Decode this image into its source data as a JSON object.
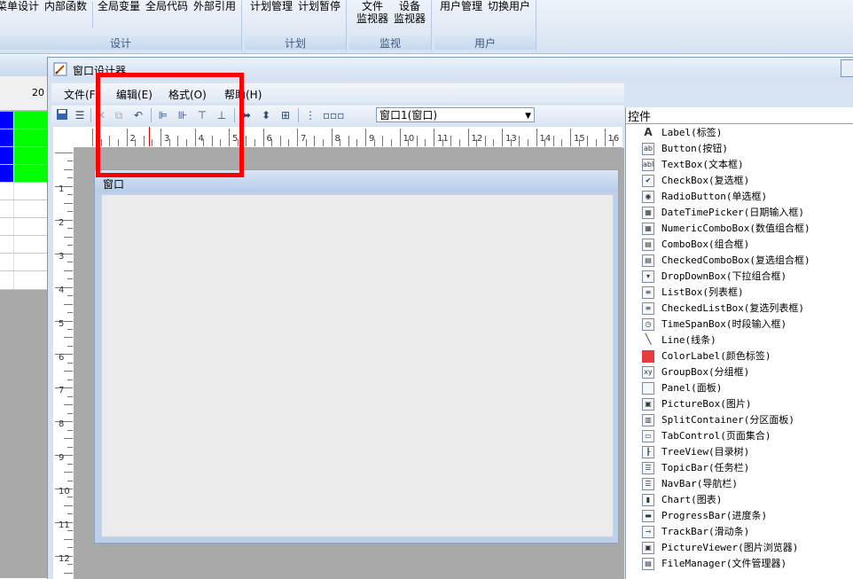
{
  "ribbon": {
    "groups": [
      {
        "title": "设计",
        "items": [
          "菜单设计",
          "内部函数",
          "全局变量",
          "全局代码",
          "外部引用"
        ]
      },
      {
        "title": "计划",
        "items": [
          "计划管理",
          "计划暂停"
        ]
      },
      {
        "title": "监视",
        "items": [
          {
            "line1": "文件",
            "line2": "监视器"
          },
          {
            "line1": "设备",
            "line2": "监视器"
          }
        ]
      },
      {
        "title": "用户",
        "items": [
          "用户管理",
          "切换用户"
        ]
      }
    ]
  },
  "background": {
    "column_header": "20"
  },
  "window": {
    "title": "窗口设计器",
    "menus": [
      "文件(F)",
      "编辑(E)",
      "格式(O)",
      "帮助(H)"
    ],
    "form_selector": "窗口1(窗口)",
    "ruler_h": [
      "1",
      "2",
      "3",
      "4",
      "5",
      "6",
      "7",
      "8",
      "9",
      "10",
      "11",
      "12",
      "13",
      "14",
      "15",
      "16"
    ],
    "ruler_v": [
      "1",
      "2",
      "3",
      "4",
      "5",
      "6",
      "7",
      "8",
      "9",
      "10",
      "11",
      "12"
    ],
    "form_title": "窗口"
  },
  "toolbox": {
    "title": "控件",
    "items": [
      {
        "label": "Label(标签)",
        "icon": "label-icon"
      },
      {
        "label": "Button(按钮)",
        "icon": "button-icon"
      },
      {
        "label": "TextBox(文本框)",
        "icon": "textbox-icon"
      },
      {
        "label": "CheckBox(复选框)",
        "icon": "checkbox-icon"
      },
      {
        "label": "RadioButton(单选框)",
        "icon": "radio-icon"
      },
      {
        "label": "DateTimePicker(日期输入框)",
        "icon": "datetime-icon"
      },
      {
        "label": "NumericComboBox(数值组合框)",
        "icon": "numeric-combo-icon"
      },
      {
        "label": "ComboBox(组合框)",
        "icon": "combobox-icon"
      },
      {
        "label": "CheckedComboBox(复选组合框)",
        "icon": "checked-combo-icon"
      },
      {
        "label": "DropDownBox(下拉组合框)",
        "icon": "dropdown-icon"
      },
      {
        "label": "ListBox(列表框)",
        "icon": "listbox-icon"
      },
      {
        "label": "CheckedListBox(复选列表框)",
        "icon": "checked-list-icon"
      },
      {
        "label": "TimeSpanBox(时段输入框)",
        "icon": "clock-icon"
      },
      {
        "label": "Line(线条)",
        "icon": "line-icon"
      },
      {
        "label": "ColorLabel(颜色标签)",
        "icon": "color-label-icon"
      },
      {
        "label": "GroupBox(分组框)",
        "icon": "groupbox-icon"
      },
      {
        "label": "Panel(面板)",
        "icon": "panel-icon"
      },
      {
        "label": "PictureBox(图片)",
        "icon": "picture-icon"
      },
      {
        "label": "SplitContainer(分区面板)",
        "icon": "split-icon"
      },
      {
        "label": "TabControl(页面集合)",
        "icon": "tab-icon"
      },
      {
        "label": "TreeView(目录树)",
        "icon": "tree-icon"
      },
      {
        "label": "TopicBar(任务栏)",
        "icon": "topicbar-icon"
      },
      {
        "label": "NavBar(导航栏)",
        "icon": "navbar-icon"
      },
      {
        "label": "Chart(图表)",
        "icon": "chart-icon"
      },
      {
        "label": "ProgressBar(进度条)",
        "icon": "progress-icon"
      },
      {
        "label": "TrackBar(滑动条)",
        "icon": "trackbar-icon"
      },
      {
        "label": "PictureViewer(图片浏览器)",
        "icon": "picture-viewer-icon"
      },
      {
        "label": "FileManager(文件管理器)",
        "icon": "file-manager-icon"
      }
    ]
  }
}
